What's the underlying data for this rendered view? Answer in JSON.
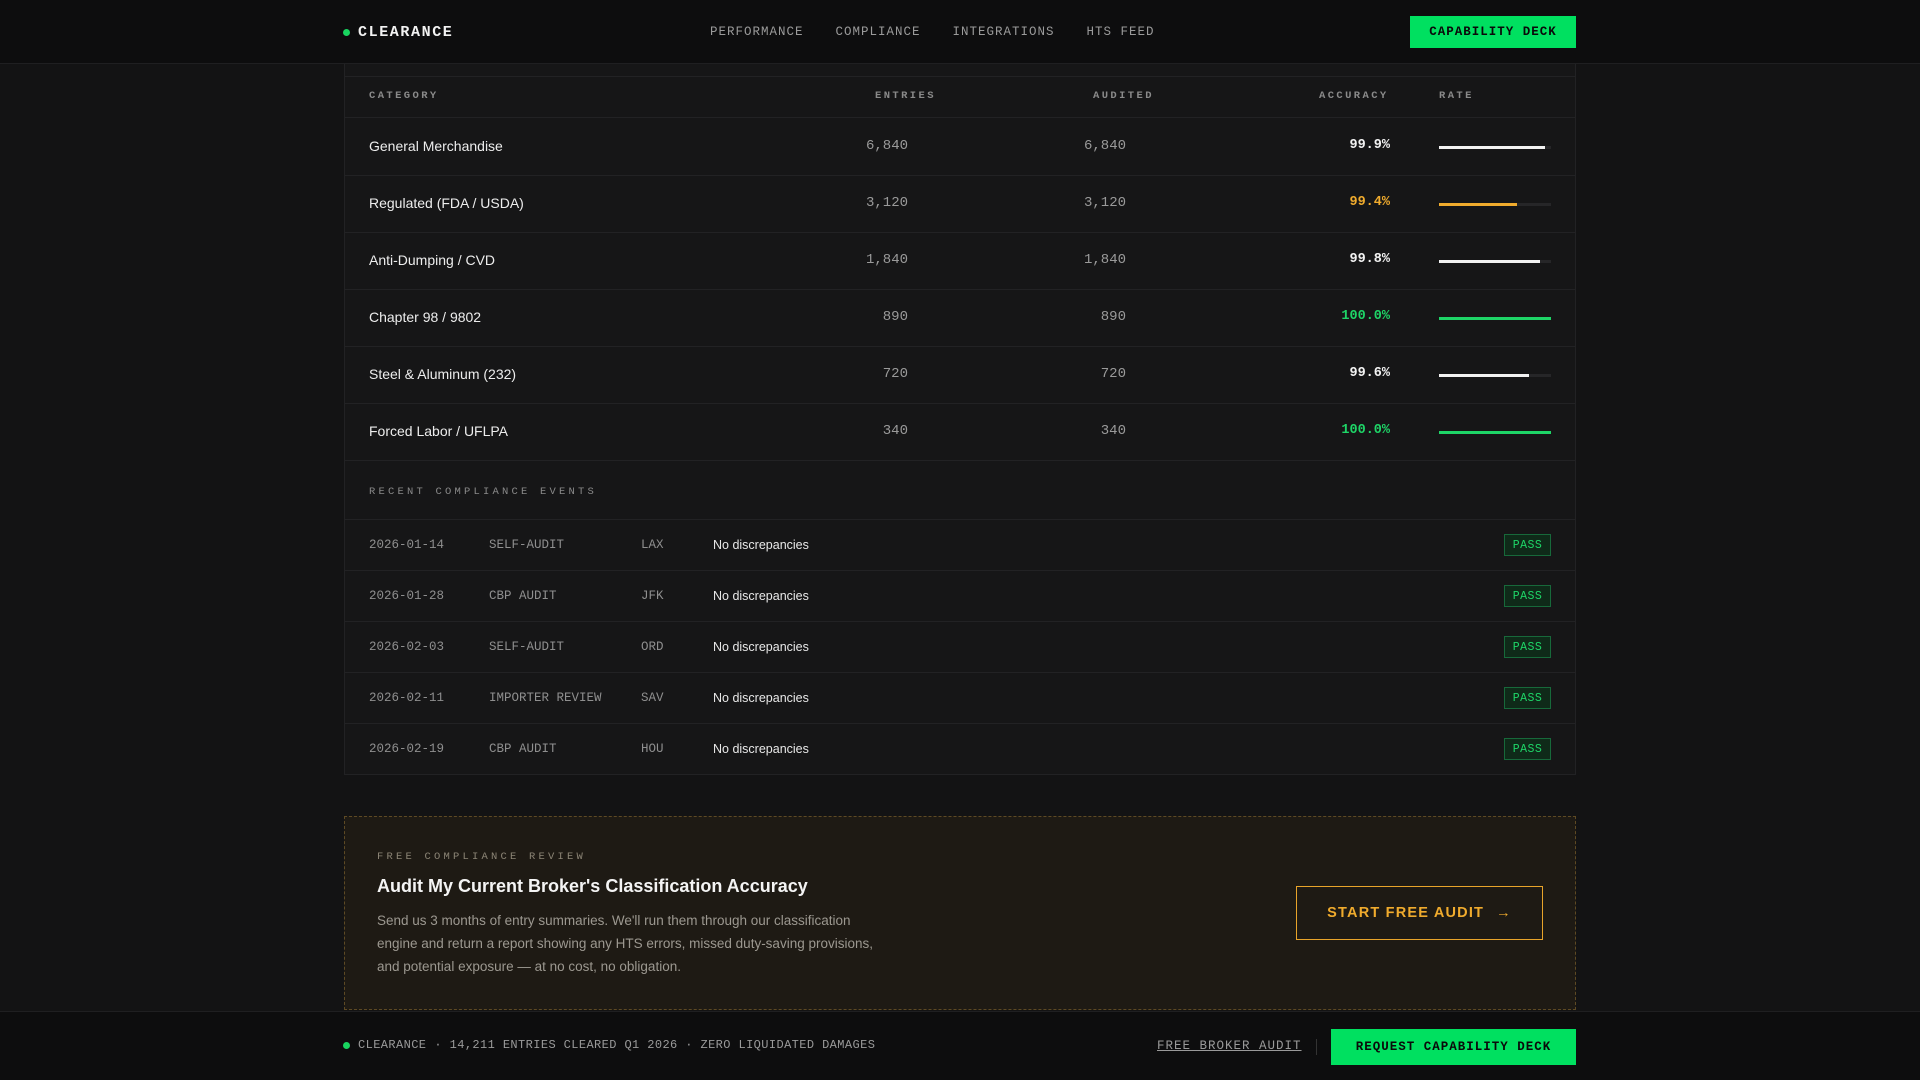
{
  "header": {
    "brand": "CLEARANCE",
    "nav": [
      "PERFORMANCE",
      "COMPLIANCE",
      "INTEGRATIONS",
      "HTS FEED"
    ],
    "cta": "CAPABILITY DECK"
  },
  "table": {
    "headers": {
      "category": "CATEGORY",
      "entries": "ENTRIES",
      "audited": "AUDITED",
      "accuracy": "ACCURACY",
      "rate": "RATE"
    },
    "rows": [
      {
        "category": "General Merchandise",
        "entries": "6,840",
        "audited": "6,840",
        "accuracy": "99.9%",
        "rate": 0.95,
        "color": "#f2f2f2"
      },
      {
        "category": "Regulated (FDA / USDA)",
        "entries": "3,120",
        "audited": "3,120",
        "accuracy": "99.4%",
        "rate": 0.7,
        "color": "#f0ab2d"
      },
      {
        "category": "Anti-Dumping / CVD",
        "entries": "1,840",
        "audited": "1,840",
        "accuracy": "99.8%",
        "rate": 0.9,
        "color": "#f2f2f2"
      },
      {
        "category": "Chapter 98 / 9802",
        "entries": "890",
        "audited": "890",
        "accuracy": "100.0%",
        "rate": 1.0,
        "color": "#1ed567"
      },
      {
        "category": "Steel & Aluminum (232)",
        "entries": "720",
        "audited": "720",
        "accuracy": "99.6%",
        "rate": 0.8,
        "color": "#f2f2f2"
      },
      {
        "category": "Forced Labor / UFLPA",
        "entries": "340",
        "audited": "340",
        "accuracy": "100.0%",
        "rate": 1.0,
        "color": "#1ed567"
      }
    ]
  },
  "events": {
    "title": "RECENT COMPLIANCE EVENTS",
    "rows": [
      {
        "date": "2026-01-14",
        "type": "SELF-AUDIT",
        "port": "LAX",
        "desc": "No discrepancies",
        "status": "PASS"
      },
      {
        "date": "2026-01-28",
        "type": "CBP AUDIT",
        "port": "JFK",
        "desc": "No discrepancies",
        "status": "PASS"
      },
      {
        "date": "2026-02-03",
        "type": "SELF-AUDIT",
        "port": "ORD",
        "desc": "No discrepancies",
        "status": "PASS"
      },
      {
        "date": "2026-02-11",
        "type": "IMPORTER REVIEW",
        "port": "SAV",
        "desc": "No discrepancies",
        "status": "PASS"
      },
      {
        "date": "2026-02-19",
        "type": "CBP AUDIT",
        "port": "HOU",
        "desc": "No discrepancies",
        "status": "PASS"
      }
    ]
  },
  "cta": {
    "eyebrow": "FREE COMPLIANCE REVIEW",
    "title": "Audit My Current Broker's Classification Accuracy",
    "body": "Send us 3 months of entry summaries. We'll run them through our classification engine and return a report showing any HTS errors, missed duty-saving provisions, and potential exposure — at no cost, no obligation.",
    "button": "START FREE AUDIT",
    "button_icon": "→"
  },
  "footer": {
    "brand": "CLEARANCE",
    "stats": "· 14,211 ENTRIES CLEARED Q1 2026 · ZERO LIQUIDATED DAMAGES",
    "link": "FREE BROKER AUDIT",
    "button": "REQUEST CAPABILITY DECK"
  },
  "colors": {
    "accent_green": "#00e060",
    "accent_amber": "#f0ab2d",
    "bg": "#131314"
  }
}
